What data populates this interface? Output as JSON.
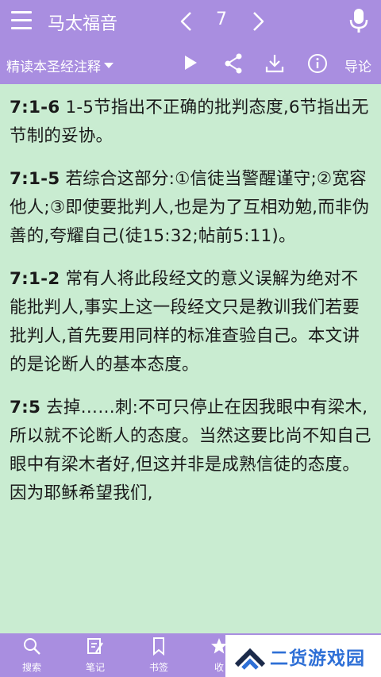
{
  "header": {
    "book_title": "马太福音",
    "chapter": "7"
  },
  "toolbar": {
    "commentary_dropdown": "精读本圣经注释",
    "guide_label": "导论"
  },
  "notes": [
    {
      "ref": "7:1-6",
      "text": " 1-5节指出不正确的批判态度,6节指出无节制的妥协。"
    },
    {
      "ref": "7:1-5",
      "text": " 若综合这部分:①信徒当警醒谨守;②宽容他人;③即使要批判人,也是为了互相劝勉,而非伪善的,夸耀自己(徒15:32;帖前5:11)。"
    },
    {
      "ref": "7:1-2",
      "text": " 常有人将此段经文的意义误解为绝对不能批判人,事实上这一段经文只是教训我们若要批判人,首先要用同样的标准查验自己。本文讲的是论断人的基本态度。"
    },
    {
      "ref": "7:5",
      "text": " 去掉……刺:不可只停止在因我眼中有梁木,所以就不论断人的态度。当然这要比尚不知自己眼中有梁木者好,但这并非是成熟信徒的态度。因为耶稣希望我们,"
    }
  ],
  "bottom_tabs": [
    {
      "label": "搜索",
      "icon": "search-icon"
    },
    {
      "label": "笔记",
      "icon": "note-icon"
    },
    {
      "label": "书签",
      "icon": "bookmark-icon"
    },
    {
      "label": "收",
      "icon": "star-icon"
    }
  ],
  "watermark": {
    "text": "二货游戏园"
  },
  "colors": {
    "bar": "#a98ee0",
    "content_bg": "#c9ecd1",
    "watermark_text": "#2e6fd6"
  }
}
